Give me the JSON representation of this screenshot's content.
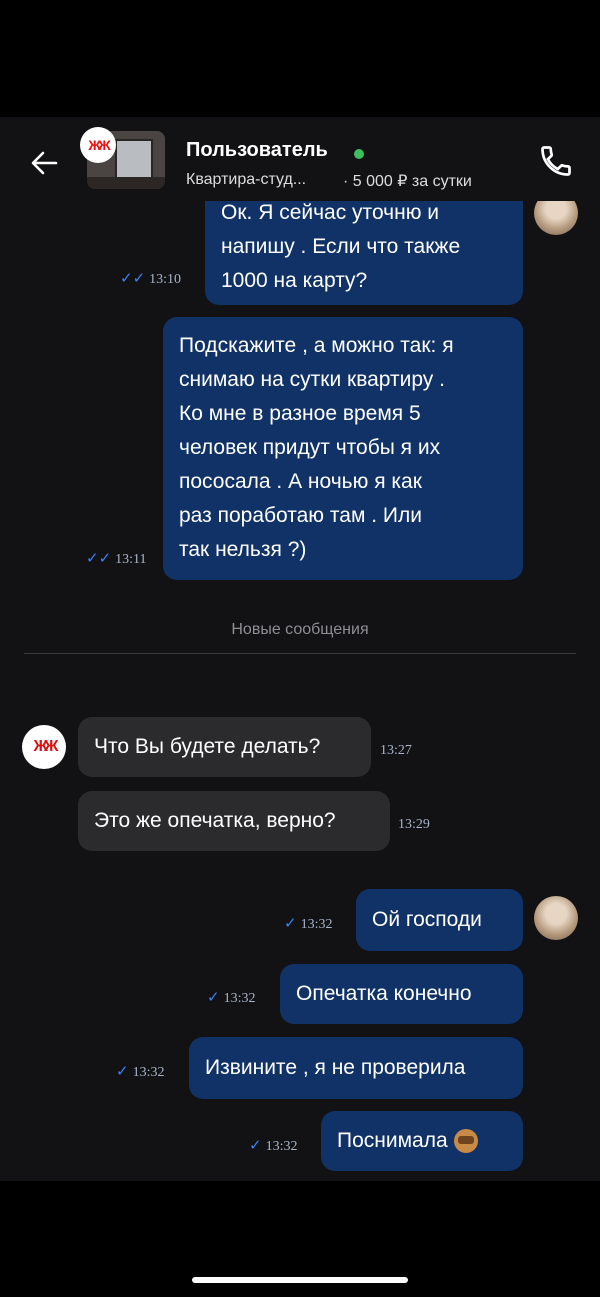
{
  "header": {
    "user_name": "Пользователь",
    "listing_title": "Квартира-студ...",
    "listing_price": "· 5 000 ₽ за сутки"
  },
  "divider": "Новые сообщения",
  "messages": [
    {
      "dir": "out",
      "lines": [
        "Ок. Я сейчас уточню и",
        "напишу . Если что также",
        "1000 на карту?"
      ],
      "time": "13:10",
      "read": true
    },
    {
      "dir": "out",
      "lines": [
        "Подскажите , а можно так: я",
        "снимаю на сутки квартиру .",
        "Ко мне в разное время 5",
        "человек придут чтобы я их",
        "пососала   . А ночью я как",
        "раз поработаю там .   Или",
        "так нельзя ?)"
      ],
      "time": "13:11",
      "read": true
    },
    {
      "dir": "in",
      "lines": [
        "Что Вы будете делать?"
      ],
      "time": "13:27"
    },
    {
      "dir": "in",
      "lines": [
        "Это же опечатка, верно?"
      ],
      "time": "13:29"
    },
    {
      "dir": "out",
      "lines": [
        "Ой господи"
      ],
      "time": "13:32",
      "read": false
    },
    {
      "dir": "out",
      "lines": [
        "Опечатка конечно"
      ],
      "time": "13:32",
      "read": false
    },
    {
      "dir": "out",
      "lines": [
        "Извините , я не проверила"
      ],
      "time": "13:32",
      "read": false
    },
    {
      "dir": "out",
      "lines": [
        "Поснимала"
      ],
      "time": "13:32",
      "read": false,
      "emoji": "see-no-evil-monkey"
    }
  ],
  "icons": {
    "back": "arrow-left-icon",
    "phone": "phone-icon"
  },
  "colors": {
    "out_bubble": "#103266",
    "in_bubble": "#2b2b2d",
    "online": "#3dbf5b"
  }
}
